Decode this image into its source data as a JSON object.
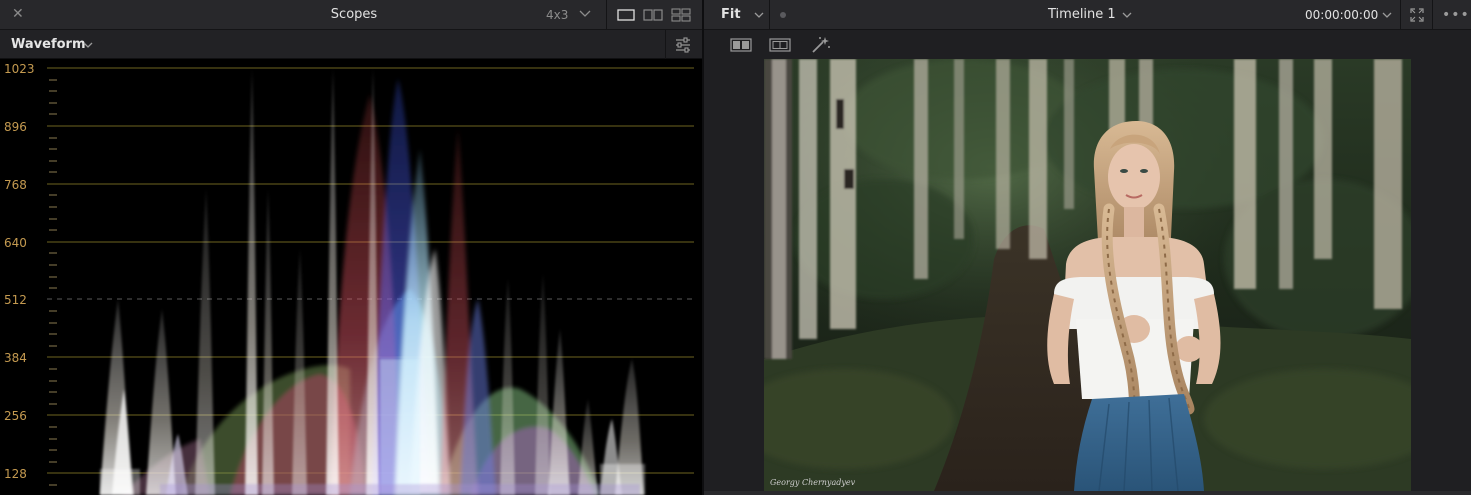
{
  "scopes": {
    "title": "Scopes",
    "grid_select": "4x3",
    "scope_type": "Waveform",
    "scale_labels": [
      "1023",
      "896",
      "768",
      "640",
      "512",
      "384",
      "256",
      "128"
    ]
  },
  "viewer": {
    "zoom": "Fit",
    "timeline_name": "Timeline 1",
    "timecode": "00:00:00:00",
    "image_signature": "Georgy Chernyadyev"
  },
  "icons": {
    "close": "close-icon",
    "chevron": "chevron-down-icon",
    "single_layout": "single-scope-layout-icon",
    "dual_layout": "dual-scope-layout-icon",
    "quad_layout": "quad-scope-layout-icon",
    "settings": "scope-settings-icon",
    "expand": "expand-icon",
    "more": "more-options-icon",
    "wipe": "wipe-view-icon",
    "safe_area": "safe-area-icon",
    "magic": "magic-wand-icon"
  },
  "colors": {
    "scale_text": "#c49a50",
    "graticule": "#6e6520",
    "panel_bg": "#28282b"
  }
}
